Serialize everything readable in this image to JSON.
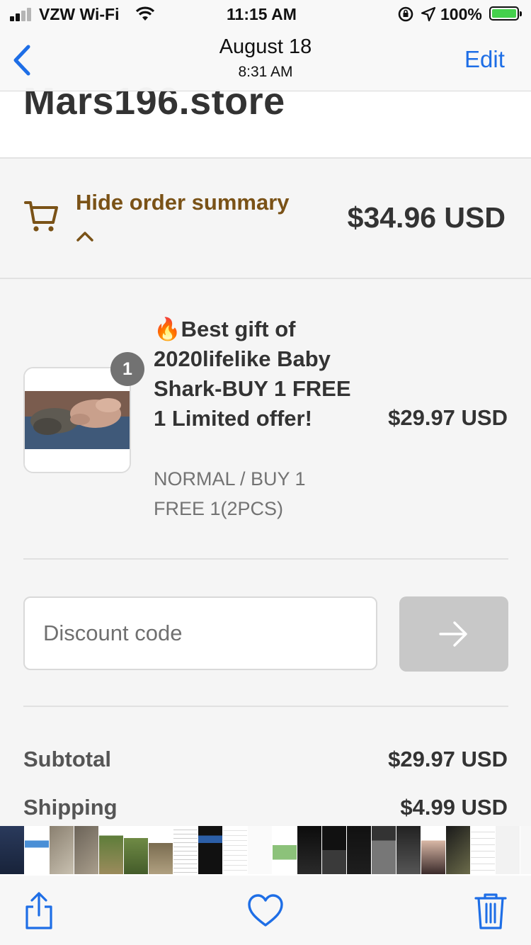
{
  "status_bar": {
    "carrier": "VZW Wi-Fi",
    "time": "11:15 AM",
    "battery": "100%"
  },
  "photo_nav": {
    "date": "August 18",
    "time": "8:31 AM",
    "edit_label": "Edit"
  },
  "store": {
    "name": "Mars196.store"
  },
  "order_summary": {
    "toggle_label": "Hide order summary",
    "total": "$34.96 USD"
  },
  "product": {
    "quantity": "1",
    "emoji": "🔥",
    "title": "Best gift of 2020lifelike Baby Shark-BUY 1 FREE 1 Limited offer!",
    "variant": "NORMAL / BUY 1 FREE 1(2PCS)",
    "price": "$29.97 USD"
  },
  "discount": {
    "placeholder": "Discount code"
  },
  "totals": {
    "subtotal_label": "Subtotal",
    "subtotal_value": "$29.97 USD",
    "shipping_label": "Shipping",
    "shipping_value": "$4.99 USD"
  },
  "colors": {
    "accent_blue": "#1e6ee6",
    "brown_link": "#7a5217",
    "battery_green": "#44d14c"
  },
  "icons": {
    "back": "chevron-left-icon",
    "cart": "cart-icon",
    "share": "share-icon",
    "favorite": "heart-icon",
    "delete": "trash-icon",
    "apply": "arrow-right-icon"
  }
}
